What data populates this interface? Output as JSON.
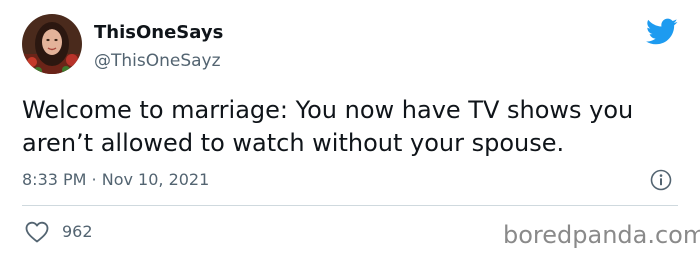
{
  "tweet": {
    "display_name": "ThisOneSays",
    "handle": "@ThisOneSayz",
    "text": "Welcome to marriage: You now have TV shows you aren’t allowed to watch without your spouse.",
    "timestamp": "8:33 PM · Nov 10, 2021",
    "like_count": "962"
  },
  "icons": {
    "brand": "twitter-bird-icon",
    "info": "info-icon",
    "like": "heart-icon"
  },
  "colors": {
    "brand": "#1d9bf0",
    "text": "#0f1419",
    "muted": "#536471",
    "divider": "#cfd9de",
    "watermark": "#8a8a8a"
  },
  "watermark": "boredpanda.com"
}
